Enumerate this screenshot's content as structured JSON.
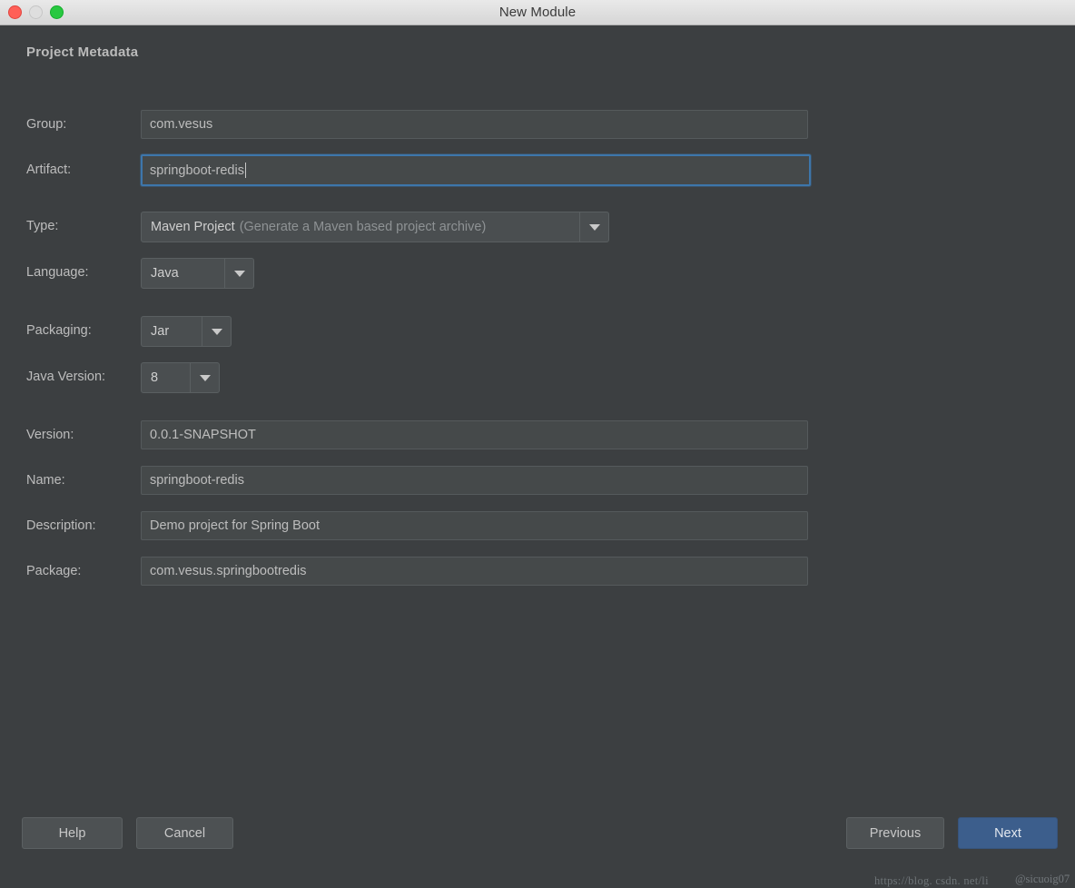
{
  "window": {
    "title": "New Module",
    "traffic_lights": [
      {
        "name": "close",
        "color": "#ff5f57"
      },
      {
        "name": "minimize",
        "color": "#dedede"
      },
      {
        "name": "zoom",
        "color": "#28c840"
      }
    ]
  },
  "section": {
    "title": "Project Metadata"
  },
  "form": {
    "group": {
      "label": "Group:",
      "value": "com.vesus",
      "focused": false
    },
    "artifact": {
      "label": "Artifact:",
      "value": "springboot-redis",
      "focused": true
    },
    "type": {
      "label": "Type:",
      "value": "Maven Project",
      "hint": "(Generate a Maven based project archive)"
    },
    "language": {
      "label": "Language:",
      "value": "Java"
    },
    "packaging": {
      "label": "Packaging:",
      "value": "Jar"
    },
    "java_version": {
      "label": "Java Version:",
      "value": "8"
    },
    "version": {
      "label": "Version:",
      "value": "0.0.1-SNAPSHOT"
    },
    "name": {
      "label": "Name:",
      "value": "springboot-redis"
    },
    "description": {
      "label": "Description:",
      "value": "Demo project for Spring Boot"
    },
    "package": {
      "label": "Package:",
      "value": "com.vesus.springbootredis"
    }
  },
  "buttons": {
    "help": "Help",
    "cancel": "Cancel",
    "previous": "Previous",
    "next": "Next"
  },
  "watermark": {
    "url": "https://blog. csdn. net/li",
    "badge": "@sicuoig07"
  },
  "colors": {
    "dialog_background": "#3c3f41",
    "field_background": "#45494a",
    "focus_border": "#3d76ab",
    "primary_button": "#3c5e8c",
    "text": "#bdbdbd"
  }
}
